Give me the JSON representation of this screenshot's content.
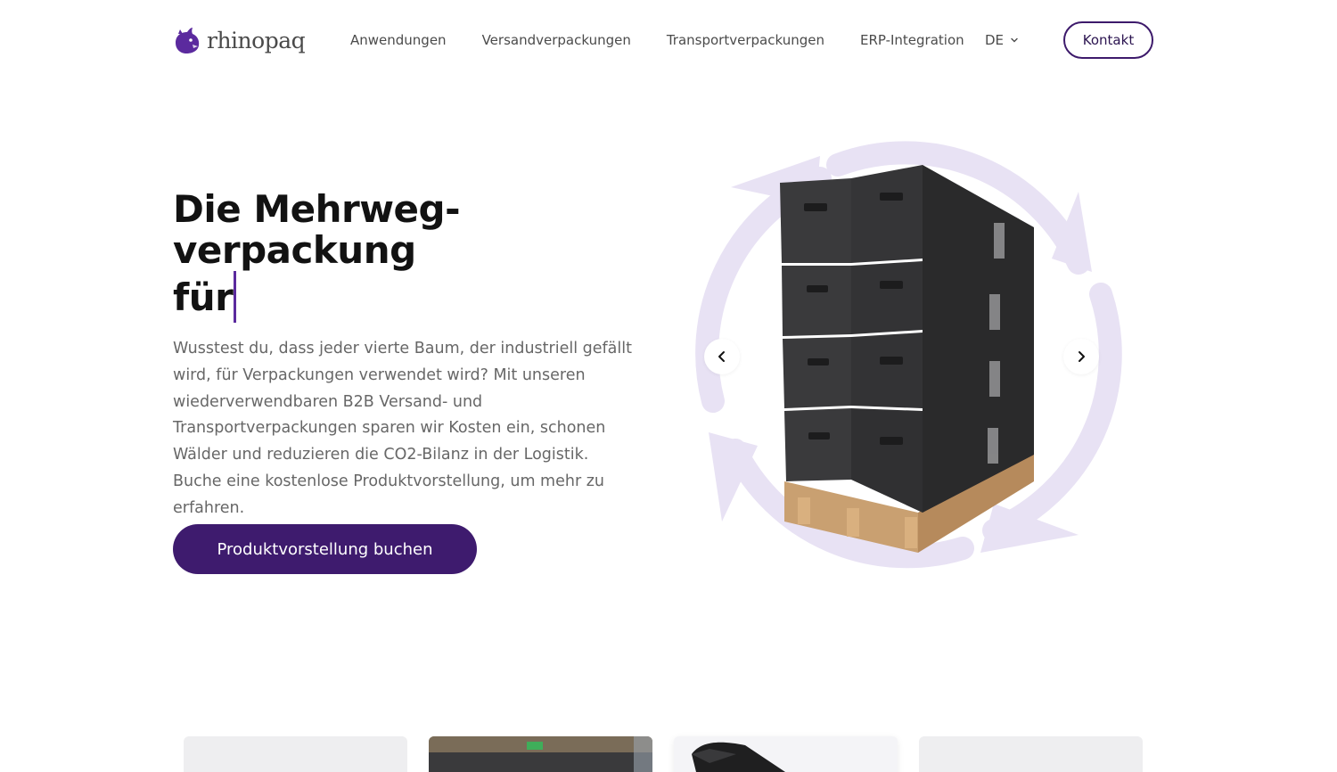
{
  "brand": {
    "name": "rhinopaq",
    "accent": "#3e1b6e",
    "cycle_color": "#e8e2f4"
  },
  "nav": {
    "items": [
      {
        "label": "Anwendungen"
      },
      {
        "label": "Versandverpackungen"
      },
      {
        "label": "Transportverpackungen"
      },
      {
        "label": "ERP-Integration"
      }
    ],
    "language": "DE",
    "contact_label": "Kontakt"
  },
  "hero": {
    "title_line1": "Die Mehrweg-",
    "title_line2": "verpackung",
    "title_line3": "für",
    "description": "Wusstest du, dass jeder vierte Baum, der industriell gefällt wird, für Verpackungen verwendet wird? Mit unseren wiederverwendbaren B2B Versand- und Transportverpackungen sparen wir Kosten ein, schonen Wälder und reduzieren die CO2-Bilanz in der Logistik. Buche eine kostenlose Produktvorstellung, um mehr zu erfahren.",
    "cta_label": "Produktvorstellung buchen"
  },
  "carousel": {
    "prev_icon": "chevron-left-icon",
    "next_icon": "chevron-right-icon",
    "image": "stacked-black-boxes-on-pallet"
  },
  "cards": [
    {
      "image": "placeholder"
    },
    {
      "image": "warehouse-boxes"
    },
    {
      "image": "black-box-lid"
    },
    {
      "image": "placeholder"
    }
  ]
}
